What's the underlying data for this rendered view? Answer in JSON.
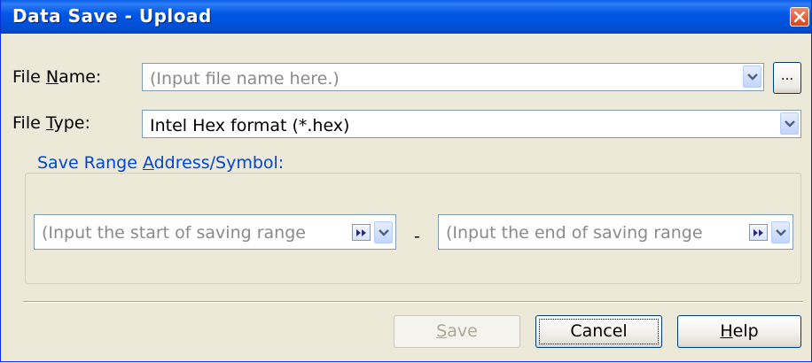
{
  "window": {
    "title": "Data Save - Upload"
  },
  "file_name": {
    "label_prefix": "File ",
    "label_mnemonic": "N",
    "label_suffix": "ame:",
    "value": "",
    "placeholder": "(Input file name here.)",
    "browse_label": "..."
  },
  "file_type": {
    "label_prefix": "File ",
    "label_mnemonic": "T",
    "label_suffix": "ype:",
    "value": "Intel Hex format (*.hex)"
  },
  "save_range": {
    "legend_prefix": "Save Range ",
    "legend_mnemonic": "A",
    "legend_suffix": "ddress/Symbol:",
    "start_placeholder": "(Input the start of saving range",
    "end_placeholder": "(Input the end of saving range",
    "separator": "-"
  },
  "buttons": {
    "save": {
      "mnemonic": "S",
      "rest": "ave",
      "enabled": false
    },
    "cancel": {
      "label": "Cancel",
      "focused": true
    },
    "help": {
      "mnemonic": "H",
      "rest": "elp"
    }
  },
  "colors": {
    "title_bar": "#0058e6",
    "dialog_bg": "#ece9d8",
    "group_legend": "#0046d5",
    "close_button": "#d9441c"
  },
  "icons": [
    "close-icon",
    "chevron-down-icon",
    "ellipsis-icon",
    "symbol-arrow-icon"
  ]
}
